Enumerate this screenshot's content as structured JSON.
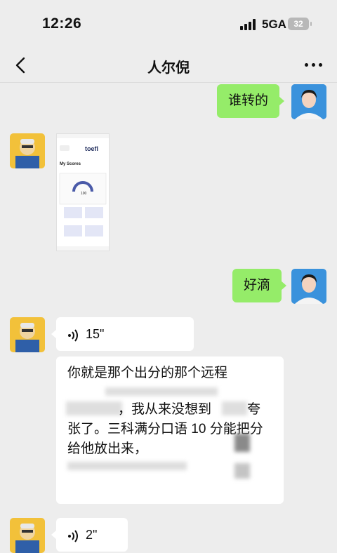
{
  "status_bar": {
    "time": "12:26",
    "network": "5GA",
    "battery": "32"
  },
  "nav": {
    "title": "人尔倪"
  },
  "messages": {
    "m1_text": "谁转的",
    "m2_screenshot": {
      "brand": "toefl",
      "heading": "My Scores",
      "score": "100"
    },
    "m3_text": "好滴",
    "m4_voice": "15\"",
    "m5_transcript": {
      "line1": "你就是那个出分的那个远程",
      "line2": "，我从来没想到",
      "line2b": "夸",
      "line3": "张了。三科满分口语 10 分能把分",
      "line4": "给他放出来，"
    },
    "m6_voice": "2\""
  },
  "colors": {
    "me_bubble": "#95ec69",
    "in_bubble": "#ffffff",
    "background": "#ededed"
  }
}
